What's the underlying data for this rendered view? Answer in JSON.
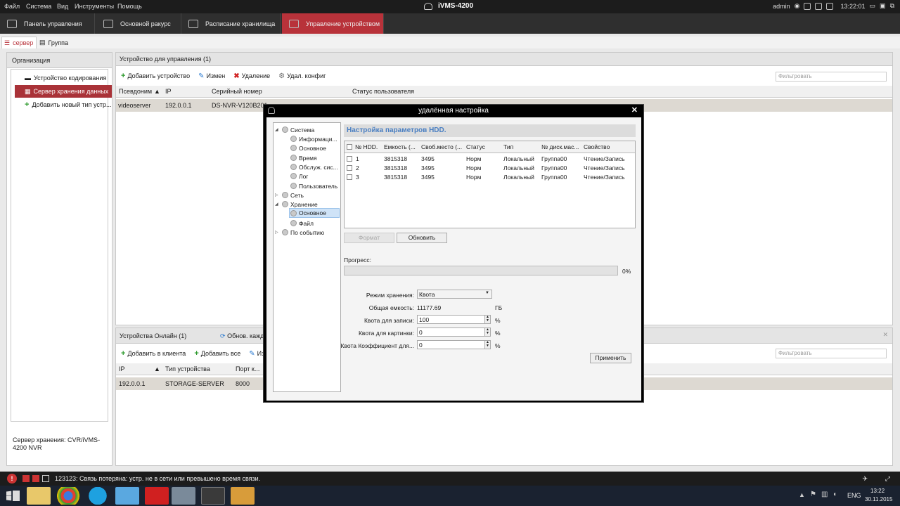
{
  "app": {
    "title": "iVMS-4200",
    "user": "admin",
    "clock": "13:22:01"
  },
  "menu": [
    "Файл",
    "Система",
    "Вид",
    "Инструменты",
    "Помощь"
  ],
  "tabs": [
    "Панель управления",
    "Основной ракурс",
    "Расписание хранилища",
    "Управление устройством"
  ],
  "subtabs": [
    "сервер",
    "Группа"
  ],
  "left": {
    "header": "Организация",
    "items": [
      "Устройство кодирования",
      "Сервер хранения данных",
      "Добавить новый тип устр..."
    ],
    "footer": "Сервер хранения: CVR/iVMS-4200 NVR"
  },
  "devices": {
    "header": "Устройство для управления (1)",
    "toolbar": [
      "Добавить устройство",
      "Измен",
      "Удаление",
      "Удал. конфиг"
    ],
    "filter": "Фильтровать",
    "columns": [
      "Псевдоним",
      "IP",
      "Серийный номер",
      "Статус пользователя"
    ],
    "row": [
      "videoserver",
      "192.0.0.1",
      "DS-NVR-V120B201"
    ]
  },
  "online": {
    "header": "Устройства Онлайн (1)",
    "refresh": "Обнов. кажд",
    "toolbar": [
      "Добавить в клиента",
      "Добавить все",
      "Из"
    ],
    "filter": "Фильтровать",
    "columns": [
      "IP",
      "Тип устройства",
      "Порт к..."
    ],
    "row": [
      "192.0.0.1",
      "STORAGE-SERVER",
      "8000"
    ]
  },
  "status": {
    "message": "123123: Связь потеряна: устр. не в сети или превышено время связи."
  },
  "taskbar": {
    "lang": "ENG",
    "time": "13:22",
    "date": "30.11.2015"
  },
  "dialog": {
    "title": "удалённая настройка",
    "tree": {
      "system": "Система",
      "sys_items": [
        "Информаци...",
        "Основное",
        "Время",
        "Обслуж. сис...",
        "Лог",
        "Пользователь"
      ],
      "network": "Сеть",
      "storage": "Хранение",
      "stor_items": [
        "Основное",
        "Файл"
      ],
      "event": "По событию"
    },
    "section": "Настройка параметров HDD.",
    "hdd_columns": [
      "№ HDD.",
      "Емкость (...",
      "Своб.место (...",
      "Статус",
      "Тип",
      "№ диск.мас...",
      "Свойство"
    ],
    "hdd_rows": [
      [
        "1",
        "3815318",
        "3495",
        "Норм",
        "Локальный",
        "Группа00",
        "Чтение/Запись"
      ],
      [
        "2",
        "3815318",
        "3495",
        "Норм",
        "Локальный",
        "Группа00",
        "Чтение/Запись"
      ],
      [
        "3",
        "3815318",
        "3495",
        "Норм",
        "Локальный",
        "Группа00",
        "Чтение/Запись"
      ]
    ],
    "format_btn": "Формат",
    "refresh_btn": "Обновить",
    "progress_label": "Прогресс:",
    "progress_value": "0%",
    "mode_label": "Режим хранения:",
    "mode_value": "Квота",
    "total_label": "Общая емкость:",
    "total_value": "11177.69",
    "total_unit": "ГБ",
    "rec_label": "Квота для записи:",
    "rec_value": "100",
    "pic_label": "Квота для картинки:",
    "pic_value": "0",
    "coef_label": "Квота Коэффициент для...",
    "coef_value": "0",
    "pct": "%",
    "apply_btn": "Применить"
  }
}
